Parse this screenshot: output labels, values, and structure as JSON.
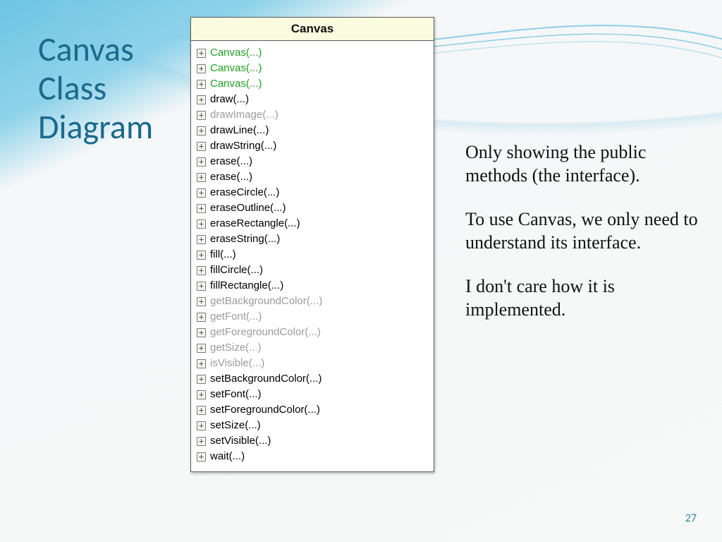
{
  "title_l1": "Canvas",
  "title_l2": "Class",
  "title_l3": "Diagram",
  "diagram": {
    "header": "Canvas",
    "methods": [
      {
        "text": "Canvas(...)",
        "kind": "constructor"
      },
      {
        "text": "Canvas(...)",
        "kind": "constructor"
      },
      {
        "text": "Canvas(...)",
        "kind": "constructor"
      },
      {
        "text": "draw(...)",
        "kind": "normal"
      },
      {
        "text": "drawImage(...)",
        "kind": "inherited"
      },
      {
        "text": "drawLine(...)",
        "kind": "normal"
      },
      {
        "text": "drawString(...)",
        "kind": "normal"
      },
      {
        "text": "erase(...)",
        "kind": "normal"
      },
      {
        "text": "erase(...)",
        "kind": "normal"
      },
      {
        "text": "eraseCircle(...)",
        "kind": "normal"
      },
      {
        "text": "eraseOutline(...)",
        "kind": "normal"
      },
      {
        "text": "eraseRectangle(...)",
        "kind": "normal"
      },
      {
        "text": "eraseString(...)",
        "kind": "normal"
      },
      {
        "text": "fill(...)",
        "kind": "normal"
      },
      {
        "text": "fillCircle(...)",
        "kind": "normal"
      },
      {
        "text": "fillRectangle(...)",
        "kind": "normal"
      },
      {
        "text": "getBackgroundColor(...)",
        "kind": "inherited"
      },
      {
        "text": "getFont(...)",
        "kind": "inherited"
      },
      {
        "text": "getForegroundColor(...)",
        "kind": "inherited"
      },
      {
        "text": "getSize(...)",
        "kind": "inherited"
      },
      {
        "text": "isVisible(...)",
        "kind": "inherited"
      },
      {
        "text": "setBackgroundColor(...)",
        "kind": "normal"
      },
      {
        "text": "setFont(...)",
        "kind": "normal"
      },
      {
        "text": "setForegroundColor(...)",
        "kind": "normal"
      },
      {
        "text": "setSize(...)",
        "kind": "normal"
      },
      {
        "text": "setVisible(...)",
        "kind": "normal"
      },
      {
        "text": "wait(...)",
        "kind": "normal"
      }
    ]
  },
  "body": {
    "p1": "Only showing the public methods (the interface).",
    "p2": "To use Canvas, we only need to understand its interface.",
    "p3": "I don't care how it is implemented."
  },
  "page_number": "27"
}
